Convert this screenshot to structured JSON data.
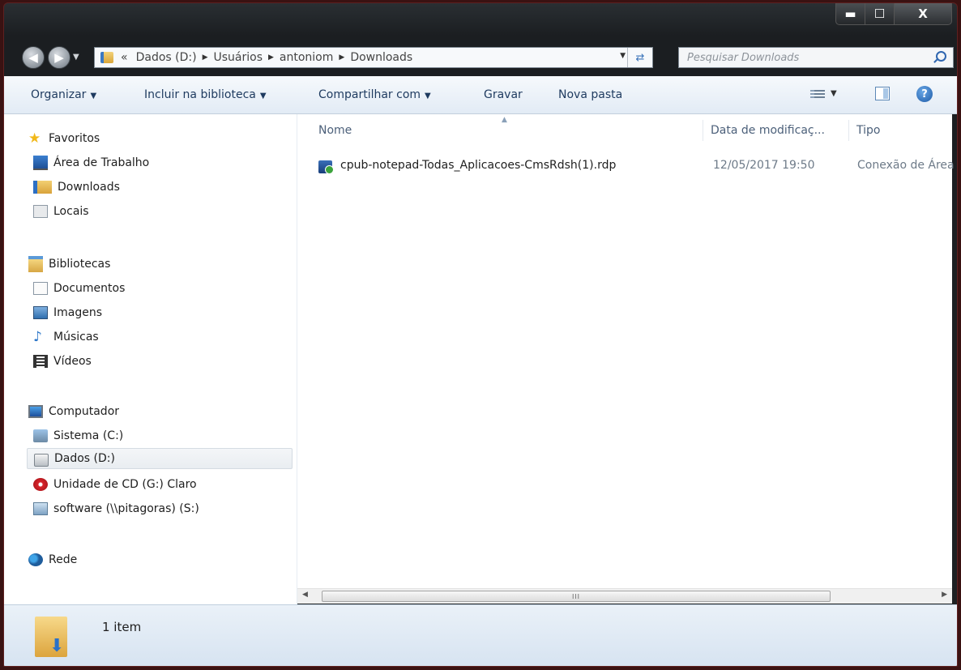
{
  "window": {
    "controls": {
      "minimize": "▬",
      "maximize": "☐",
      "close": "X"
    }
  },
  "nav": {
    "back_icon": "back-arrow-icon",
    "forward_icon": "forward-arrow-icon",
    "breadcrumb": {
      "overflow": "«",
      "segments": [
        "Dados (D:)",
        "Usuários",
        "antoniom",
        "Downloads"
      ],
      "separator": "▶"
    },
    "search_placeholder": "Pesquisar Downloads"
  },
  "toolbar": {
    "organizar": "Organizar",
    "incluir": "Incluir na biblioteca",
    "compartilhar": "Compartilhar com",
    "gravar": "Gravar",
    "nova_pasta": "Nova pasta",
    "help": "?"
  },
  "sidebar": {
    "favoritos": "Favoritos",
    "area": "Área de Trabalho",
    "downloads": "Downloads",
    "locais": "Locais",
    "bibliotecas": "Bibliotecas",
    "documentos": "Documentos",
    "imagens": "Imagens",
    "musicas": "Músicas",
    "videos": "Vídeos",
    "computador": "Computador",
    "sistema": "Sistema (C:)",
    "dados": "Dados (D:)",
    "cd": "Unidade de CD (G:) Claro",
    "software": "software (\\\\pitagoras) (S:)",
    "rede": "Rede"
  },
  "columns": {
    "name": "Nome",
    "date": "Data de modificaç...",
    "type": "Tipo"
  },
  "files": [
    {
      "name": "cpub-notepad-Todas_Aplicacoes-CmsRdsh(1).rdp",
      "date": "12/05/2017 19:50",
      "type": "Conexão de Área"
    }
  ],
  "scrollbar": {
    "grip": "III"
  },
  "status": {
    "count": "1 item"
  },
  "colors": {
    "accent": "#3b74b9",
    "frame": "#1d2023",
    "toolbar": "#e2ebf5"
  }
}
